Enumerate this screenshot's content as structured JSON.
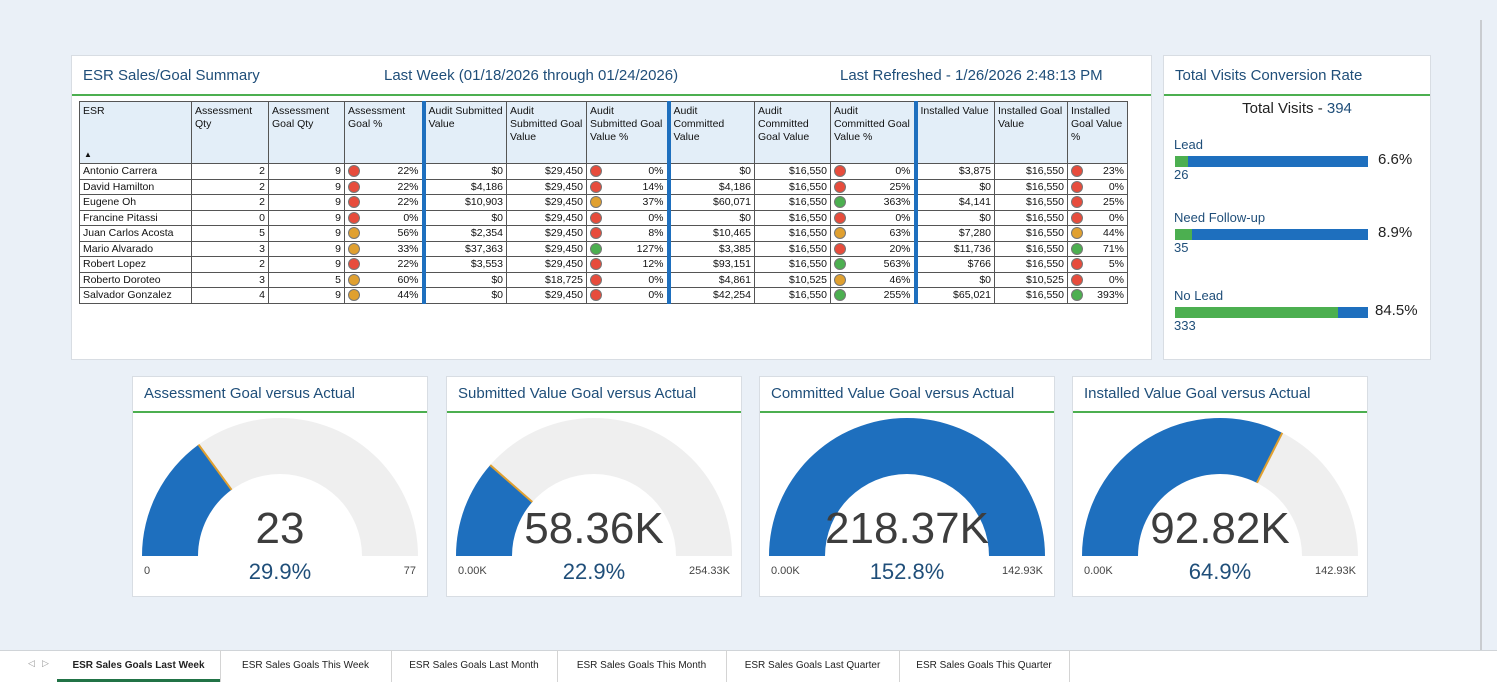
{
  "summary": {
    "title": "ESR Sales/Goal Summary",
    "period": "Last Week (01/18/2026 through 01/24/2026)",
    "refreshed": "Last Refreshed - 1/26/2026 2:48:13 PM",
    "columns": [
      "ESR",
      "Assessment Qty",
      "Assessment Goal Qty",
      "Assessment Goal %",
      "Audit Submitted Value",
      "Audit Submitted Goal Value",
      "Audit Submitted Goal Value %",
      "Audit Committed Value",
      "Audit Committed Goal Value",
      "Audit Committed Goal Value %",
      "Installed Value",
      "Installed Goal Value",
      "Installed Goal Value %"
    ],
    "sort_indicator": "▲",
    "rows": [
      {
        "esr": "Antonio Carrera",
        "aq": "2",
        "agq": "9",
        "ag": {
          "s": "red",
          "v": "22%"
        },
        "sv": "$0",
        "sg": "$29,450",
        "sp": {
          "s": "red",
          "v": "0%"
        },
        "cv": "$0",
        "cg": "$16,550",
        "cp": {
          "s": "red",
          "v": "0%"
        },
        "iv": "$3,875",
        "ig": "$16,550",
        "ip": {
          "s": "red",
          "v": "23%"
        }
      },
      {
        "esr": "David Hamilton",
        "aq": "2",
        "agq": "9",
        "ag": {
          "s": "red",
          "v": "22%"
        },
        "sv": "$4,186",
        "sg": "$29,450",
        "sp": {
          "s": "red",
          "v": "14%"
        },
        "cv": "$4,186",
        "cg": "$16,550",
        "cp": {
          "s": "red",
          "v": "25%"
        },
        "iv": "$0",
        "ig": "$16,550",
        "ip": {
          "s": "red",
          "v": "0%"
        }
      },
      {
        "esr": "Eugene Oh",
        "aq": "2",
        "agq": "9",
        "ag": {
          "s": "red",
          "v": "22%"
        },
        "sv": "$10,903",
        "sg": "$29,450",
        "sp": {
          "s": "amber",
          "v": "37%"
        },
        "cv": "$60,071",
        "cg": "$16,550",
        "cp": {
          "s": "green",
          "v": "363%"
        },
        "iv": "$4,141",
        "ig": "$16,550",
        "ip": {
          "s": "red",
          "v": "25%"
        }
      },
      {
        "esr": "Francine Pitassi",
        "aq": "0",
        "agq": "9",
        "ag": {
          "s": "red",
          "v": "0%"
        },
        "sv": "$0",
        "sg": "$29,450",
        "sp": {
          "s": "red",
          "v": "0%"
        },
        "cv": "$0",
        "cg": "$16,550",
        "cp": {
          "s": "red",
          "v": "0%"
        },
        "iv": "$0",
        "ig": "$16,550",
        "ip": {
          "s": "red",
          "v": "0%"
        }
      },
      {
        "esr": "Juan Carlos Acosta",
        "aq": "5",
        "agq": "9",
        "ag": {
          "s": "amber",
          "v": "56%"
        },
        "sv": "$2,354",
        "sg": "$29,450",
        "sp": {
          "s": "red",
          "v": "8%"
        },
        "cv": "$10,465",
        "cg": "$16,550",
        "cp": {
          "s": "amber",
          "v": "63%"
        },
        "iv": "$7,280",
        "ig": "$16,550",
        "ip": {
          "s": "amber",
          "v": "44%"
        }
      },
      {
        "esr": "Mario Alvarado",
        "aq": "3",
        "agq": "9",
        "ag": {
          "s": "amber",
          "v": "33%"
        },
        "sv": "$37,363",
        "sg": "$29,450",
        "sp": {
          "s": "green",
          "v": "127%"
        },
        "cv": "$3,385",
        "cg": "$16,550",
        "cp": {
          "s": "red",
          "v": "20%"
        },
        "iv": "$11,736",
        "ig": "$16,550",
        "ip": {
          "s": "green",
          "v": "71%"
        }
      },
      {
        "esr": "Robert Lopez",
        "aq": "2",
        "agq": "9",
        "ag": {
          "s": "red",
          "v": "22%"
        },
        "sv": "$3,553",
        "sg": "$29,450",
        "sp": {
          "s": "red",
          "v": "12%"
        },
        "cv": "$93,151",
        "cg": "$16,550",
        "cp": {
          "s": "green",
          "v": "563%"
        },
        "iv": "$766",
        "ig": "$16,550",
        "ip": {
          "s": "red",
          "v": "5%"
        }
      },
      {
        "esr": "Roberto Doroteo",
        "aq": "3",
        "agq": "5",
        "ag": {
          "s": "amber",
          "v": "60%"
        },
        "sv": "$0",
        "sg": "$18,725",
        "sp": {
          "s": "red",
          "v": "0%"
        },
        "cv": "$4,861",
        "cg": "$10,525",
        "cp": {
          "s": "amber",
          "v": "46%"
        },
        "iv": "$0",
        "ig": "$10,525",
        "ip": {
          "s": "red",
          "v": "0%"
        }
      },
      {
        "esr": "Salvador Gonzalez",
        "aq": "4",
        "agq": "9",
        "ag": {
          "s": "amber",
          "v": "44%"
        },
        "sv": "$0",
        "sg": "$29,450",
        "sp": {
          "s": "red",
          "v": "0%"
        },
        "cv": "$42,254",
        "cg": "$16,550",
        "cp": {
          "s": "green",
          "v": "255%"
        },
        "iv": "$65,021",
        "ig": "$16,550",
        "ip": {
          "s": "green",
          "v": "393%"
        }
      }
    ]
  },
  "conversion": {
    "title": "Total Visits Conversion Rate",
    "total_label": "Total Visits - ",
    "total_value": "394",
    "items": [
      {
        "label": "Lead",
        "pct": "6.6%",
        "count": "26",
        "fraction": 0.066
      },
      {
        "label": "Need Follow-up",
        "pct": "8.9%",
        "count": "35",
        "fraction": 0.089
      },
      {
        "label": "No Lead",
        "pct": "84.5%",
        "count": "333",
        "fraction": 0.845
      }
    ],
    "colors": {
      "bar": "#1e6fbe",
      "fill": "#4caf50"
    }
  },
  "gauges": [
    {
      "title": "Assessment Goal versus Actual",
      "value": "23",
      "pct": "29.9%",
      "min": "0",
      "max": "77",
      "fraction": 0.299
    },
    {
      "title": "Submitted Value Goal versus Actual",
      "value": "58.36K",
      "pct": "22.9%",
      "min": "0.00K",
      "max": "254.33K",
      "fraction": 0.229
    },
    {
      "title": "Committed Value Goal versus Actual",
      "value": "218.37K",
      "pct": "152.8%",
      "min": "0.00K",
      "max": "142.93K",
      "fraction": 1.0
    },
    {
      "title": "Installed Value Goal versus Actual",
      "value": "92.82K",
      "pct": "64.9%",
      "min": "0.00K",
      "max": "142.93K",
      "fraction": 0.649
    }
  ],
  "gauge_colors": {
    "track": "#efefef",
    "fill": "#1e6fbe",
    "tick": "#e0a030"
  },
  "tabs": [
    {
      "label": "ESR Sales Goals Last Week",
      "active": true
    },
    {
      "label": "ESR Sales Goals This Week",
      "active": false
    },
    {
      "label": "ESR Sales Goals Last Month",
      "active": false
    },
    {
      "label": "ESR Sales Goals This Month",
      "active": false
    },
    {
      "label": "ESR Sales Goals Last Quarter",
      "active": false
    },
    {
      "label": "ESR Sales Goals This Quarter",
      "active": false
    }
  ],
  "tab_nav": {
    "prev": "◁",
    "next": "▷"
  }
}
